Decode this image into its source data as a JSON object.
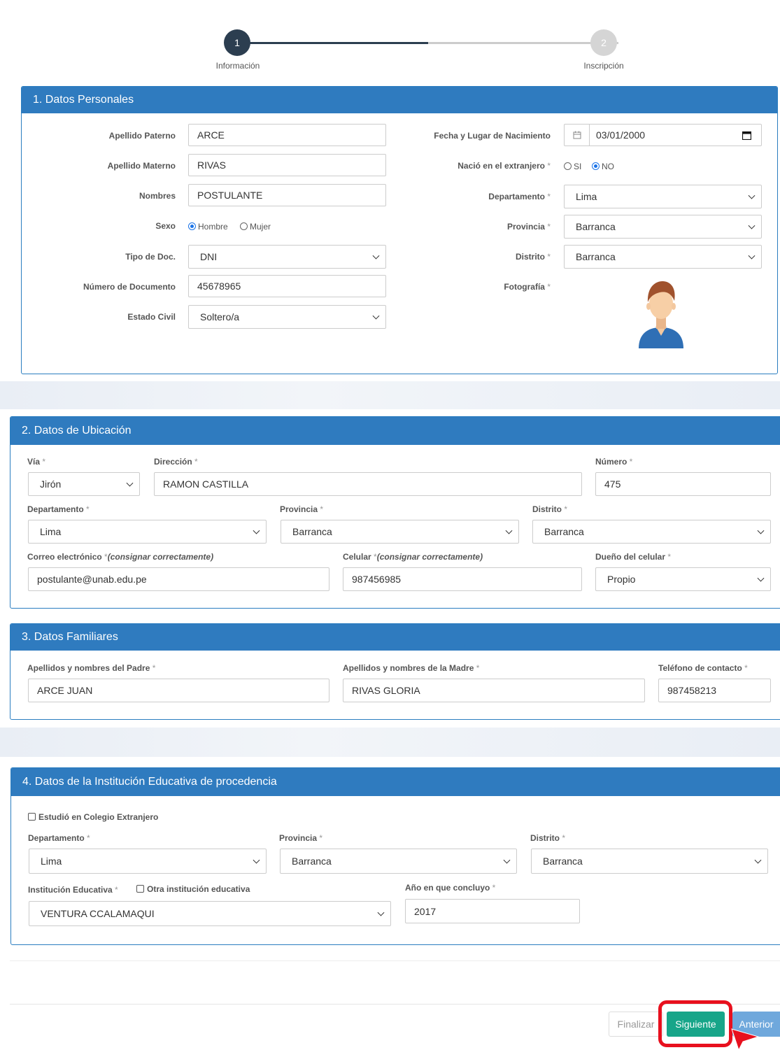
{
  "stepper": {
    "steps": [
      {
        "number": "1",
        "label": "Información"
      },
      {
        "number": "2",
        "label": "Inscripción"
      }
    ]
  },
  "personal": {
    "title": "1. Datos Personales",
    "apellido_paterno": {
      "label": "Apellido Paterno",
      "value": "ARCE"
    },
    "apellido_materno": {
      "label": "Apellido Materno",
      "value": "RIVAS"
    },
    "nombres": {
      "label": "Nombres",
      "value": "POSTULANTE"
    },
    "sexo": {
      "label": "Sexo",
      "option1": "Hombre",
      "option2": "Mujer",
      "selected": "Hombre"
    },
    "tipo_doc": {
      "label": "Tipo de Doc.",
      "value": "DNI"
    },
    "numero_doc": {
      "label": "Número de Documento",
      "value": "45678965"
    },
    "estado_civil": {
      "label": "Estado Civil",
      "value": "Soltero/a"
    },
    "fecha_nac": {
      "label": "Fecha y Lugar de Nacimiento",
      "value": "03/01/2000"
    },
    "extranjero": {
      "label": "Nació en el extranjero",
      "option1": "SI",
      "option2": "NO",
      "selected": "NO"
    },
    "departamento": {
      "label": "Departamento",
      "value": "Lima"
    },
    "provincia": {
      "label": "Provincia",
      "value": "Barranca"
    },
    "distrito": {
      "label": "Distrito",
      "value": "Barranca"
    },
    "fotografia": {
      "label": "Fotografía"
    }
  },
  "ubicacion": {
    "title": "2. Datos de Ubicación",
    "via": {
      "label": "Vía",
      "value": "Jirón"
    },
    "direccion": {
      "label": "Dirección",
      "value": "RAMON CASTILLA"
    },
    "numero": {
      "label": "Número",
      "value": "475"
    },
    "departamento": {
      "label": "Departamento",
      "value": "Lima"
    },
    "provincia": {
      "label": "Provincia",
      "value": "Barranca"
    },
    "distrito": {
      "label": "Distrito",
      "value": "Barranca"
    },
    "correo": {
      "label": "Correo electrónico",
      "note": "(consignar correctamente)",
      "value": "postulante@unab.edu.pe"
    },
    "celular": {
      "label": "Celular",
      "note": "(consignar correctamente)",
      "value": "987456985"
    },
    "dueno": {
      "label": "Dueño del celular",
      "value": "Propio"
    }
  },
  "familiares": {
    "title": "3. Datos Familiares",
    "padre": {
      "label": "Apellidos y nombres del Padre",
      "value": "ARCE JUAN"
    },
    "madre": {
      "label": "Apellidos y nombres de la Madre",
      "value": "RIVAS GLORIA"
    },
    "telefono": {
      "label": "Teléfono de contacto",
      "value": "987458213"
    }
  },
  "institucion": {
    "title": "4. Datos de la Institución Educativa de procedencia",
    "extranjero_label": "Estudió en Colegio Extranjero",
    "departamento": {
      "label": "Departamento",
      "value": "Lima"
    },
    "provincia": {
      "label": "Provincia",
      "value": "Barranca"
    },
    "distrito": {
      "label": "Distrito",
      "value": "Barranca"
    },
    "ie": {
      "label": "Institución Educativa",
      "value": "VENTURA CCALAMAQUI"
    },
    "otra_label": "Otra institución educativa",
    "anio": {
      "label": "Año en que concluyo",
      "value": "2017"
    }
  },
  "footer": {
    "finalizar": "Finalizar",
    "siguiente": "Siguiente",
    "anterior": "Anterior"
  },
  "colors": {
    "header_blue": "#2f7bbf",
    "step_dark": "#2c3e50",
    "next_green": "#17a589",
    "highlight_red": "#e8101e"
  }
}
